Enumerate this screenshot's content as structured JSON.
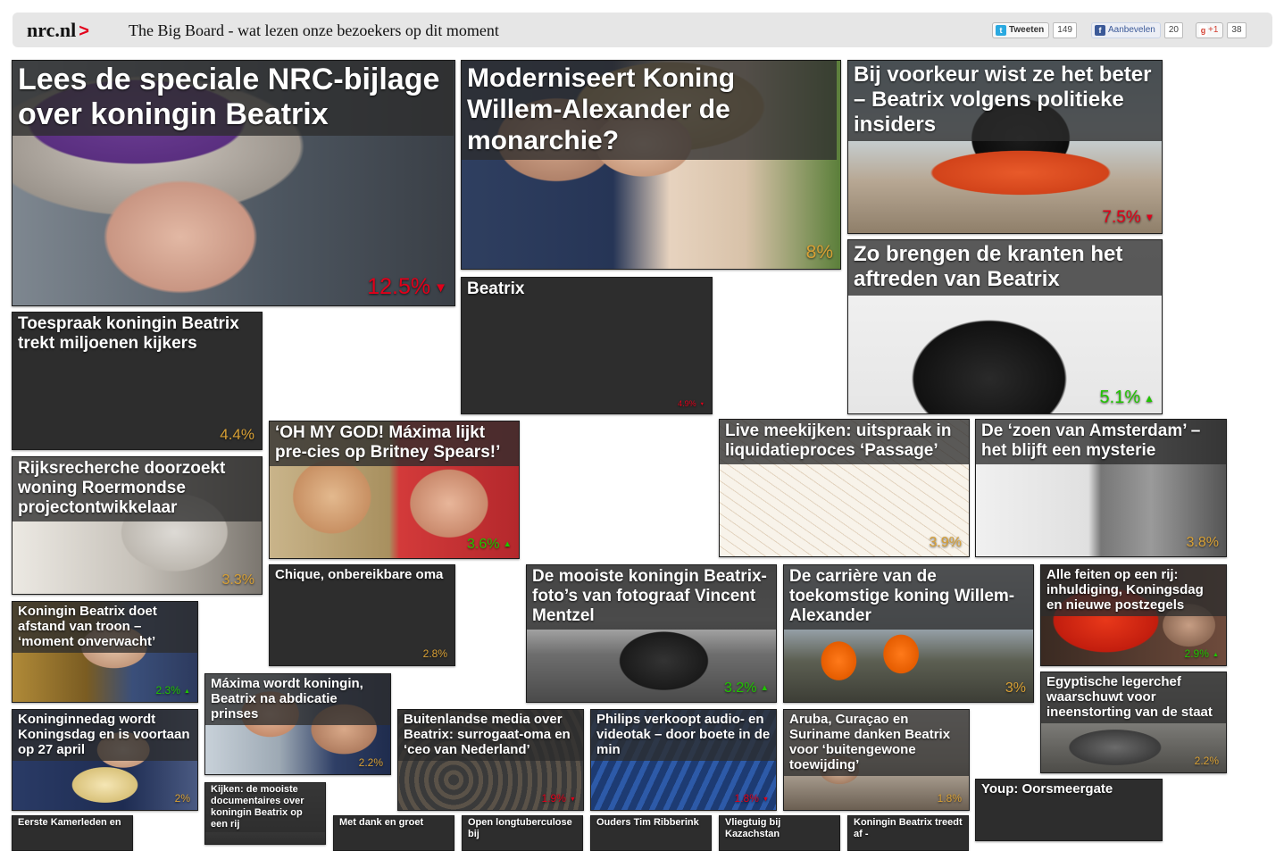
{
  "header": {
    "logo": "nrc.nl",
    "logo_chevron": ">",
    "tagline": "The Big Board - wat lezen onze bezoekers op dit moment",
    "twitter": {
      "label": "Tweeten",
      "count": "149"
    },
    "facebook": {
      "label": "Aanbevelen",
      "count": "20"
    },
    "gplus": {
      "label": "+1",
      "count": "38"
    }
  },
  "colors": {
    "up": "#20c400",
    "down": "#e0001a",
    "flat": "#d8a035",
    "tile": "#2d2d2d"
  },
  "tiles": [
    {
      "title": "Lees de speciale NRC-bijlage over koningin Beatrix",
      "pct": "12.5%",
      "trend": "down",
      "image": "portrait-purple-hat"
    },
    {
      "title": "Moderniseert Koning Willem-Alexander de monarchie?",
      "pct": "8%",
      "trend": "flat",
      "image": "royal-couple"
    },
    {
      "title": "Bij voorkeur wist ze het beter – Beatrix volgens politieke insiders",
      "pct": "7.5%",
      "trend": "down",
      "image": "hat-pyramid"
    },
    {
      "title": "Beatrix",
      "pct": "4.9%",
      "trend": "down",
      "image": "none"
    },
    {
      "title": "Zo brengen de kranten het aftreden van Beatrix",
      "pct": "5.1%",
      "trend": "up",
      "image": "newspaper-bw"
    },
    {
      "title": "Toespraak koningin Beatrix trekt miljoenen kijkers",
      "pct": "4.4%",
      "trend": "flat",
      "image": "none"
    },
    {
      "title": "‘OH MY GOD! Máxima lijkt pre-cies op Britney Spears!’",
      "pct": "3.6%",
      "trend": "up",
      "image": "two-faces"
    },
    {
      "title": "Live meekijken: uitspraak in liquidatieproces ‘Passage’",
      "pct": "3.9%",
      "trend": "flat",
      "image": "court-sketch"
    },
    {
      "title": "De ‘zoen van Amsterdam’ – het blijft een mysterie",
      "pct": "3.8%",
      "trend": "flat",
      "image": "old-newspaper"
    },
    {
      "title": "Rijksrecherche doorzoekt woning Roermondse projectontwikkelaar",
      "pct": "3.3%",
      "trend": "flat",
      "image": "documents"
    },
    {
      "title": "Chique, onbereikbare oma",
      "pct": "2.8%",
      "trend": "flat",
      "image": "none"
    },
    {
      "title": "De mooiste koningin Beatrix-foto’s van fotograaf Vincent Mentzel",
      "pct": "3.2%",
      "trend": "up",
      "image": "bw-palace"
    },
    {
      "title": "De carrière van de toekomstige koning Willem-Alexander",
      "pct": "3%",
      "trend": "flat",
      "image": "worksite"
    },
    {
      "title": "Alle feiten op een rij: inhuldiging, Koningsdag en nieuwe postzegels",
      "pct": "2.9%",
      "trend": "up",
      "image": "red-orange"
    },
    {
      "title": "Koningin Beatrix doet afstand van troon – ‘moment onverwacht’",
      "pct": "2.3%",
      "trend": "up",
      "image": "queen-speech"
    },
    {
      "title": "Máxima wordt koningin, Beatrix na abdicatie prinses",
      "pct": "2.2%",
      "trend": "flat",
      "image": "royal-couple-2"
    },
    {
      "title": "Koninginnedag wordt Koningsdag en is voortaan op 27 april",
      "pct": "2%",
      "trend": "flat",
      "image": "queen-flowers"
    },
    {
      "title": "Buitenlandse media over Beatrix: surrogaat-oma en ‘ceo van Nederland’",
      "pct": "1.9%",
      "trend": "down",
      "image": "crowd"
    },
    {
      "title": "Philips verkoopt audio- en videotak – door boete in de min",
      "pct": "1.8%",
      "trend": "down",
      "image": "philips-building"
    },
    {
      "title": "Aruba, Curaçao en Suriname danken Beatrix voor ‘buitengewone toewijding’",
      "pct": "1.8%",
      "trend": "flat",
      "image": "meeting-room"
    },
    {
      "title": "Egyptische legerchef waarschuwt voor ineenstorting van de staat",
      "pct": "2.2%",
      "trend": "flat",
      "image": "burnt-car"
    },
    {
      "title": "Kijken: de mooiste documentaires over koningin Beatrix op een rij",
      "pct": "",
      "trend": "flat",
      "image": "grey-photo"
    },
    {
      "title": "Youp: Oorsmeergate",
      "pct": "",
      "trend": "flat",
      "image": "none"
    },
    {
      "title": "Eerste Kamerleden en",
      "pct": "",
      "trend": "flat",
      "image": "none"
    },
    {
      "title": "Met dank en groet",
      "pct": "",
      "trend": "flat",
      "image": "none"
    },
    {
      "title": "Open longtuberculose bij",
      "pct": "",
      "trend": "flat",
      "image": "none"
    },
    {
      "title": "Ouders Tim Ribberink",
      "pct": "",
      "trend": "flat",
      "image": "none"
    },
    {
      "title": "Vliegtuig bij Kazachstan",
      "pct": "",
      "trend": "flat",
      "image": "none"
    },
    {
      "title": "Koningin Beatrix treedt af -",
      "pct": "",
      "trend": "flat",
      "image": "none"
    }
  ]
}
